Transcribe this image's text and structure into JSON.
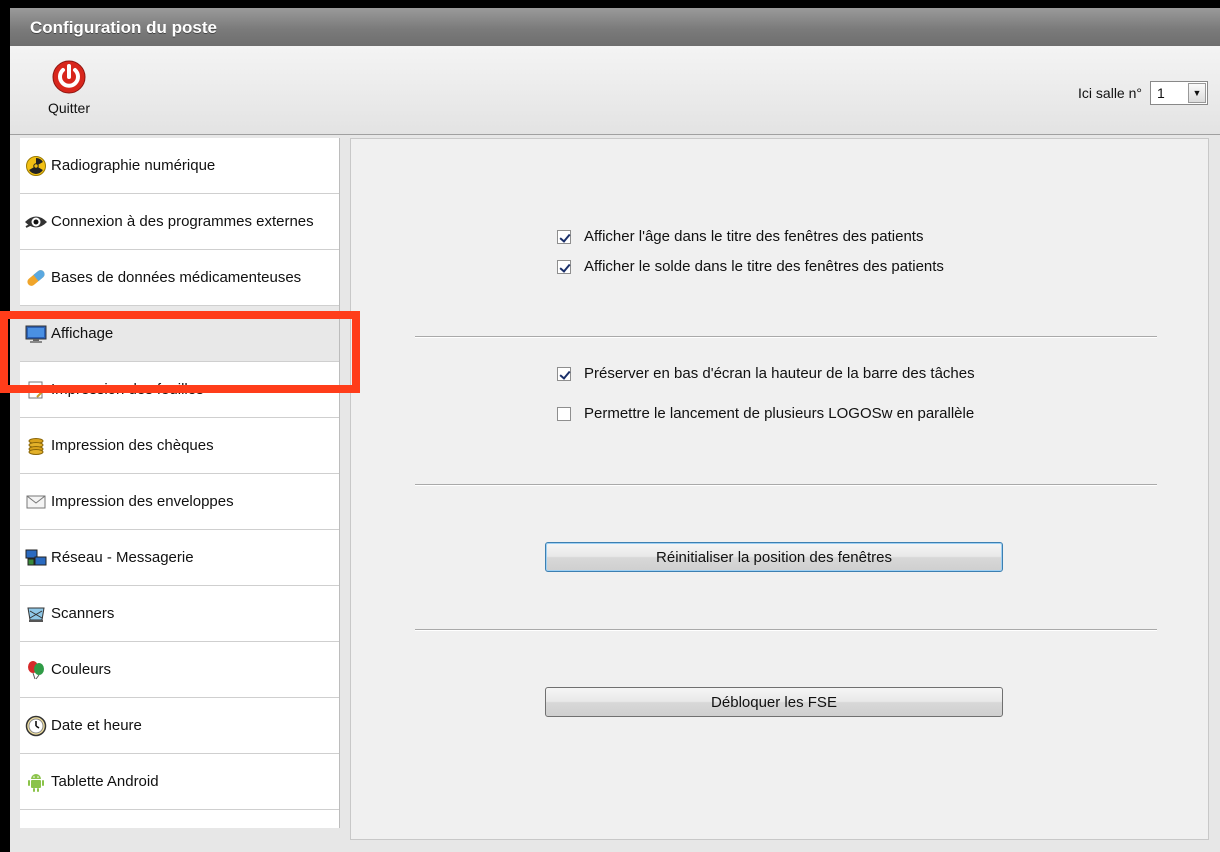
{
  "window": {
    "title": "Configuration du poste"
  },
  "toolbar": {
    "quit_label": "Quitter",
    "salle_label": "Ici salle n°",
    "salle_value": "1"
  },
  "sidebar": {
    "items": [
      {
        "label": "Radiographie numérique",
        "icon": "radiation-icon"
      },
      {
        "label": "Connexion à des programmes externes",
        "icon": "eye-icon"
      },
      {
        "label": "Bases de données médicamenteuses",
        "icon": "pill-icon"
      },
      {
        "label": "Affichage",
        "icon": "monitor-icon",
        "active": true
      },
      {
        "label": "Impression des feuilles",
        "icon": "document-icon"
      },
      {
        "label": "Impression des chèques",
        "icon": "cheque-icon"
      },
      {
        "label": "Impression des enveloppes",
        "icon": "envelope-icon"
      },
      {
        "label": "Réseau - Messagerie",
        "icon": "network-icon"
      },
      {
        "label": "Scanners",
        "icon": "scanner-icon"
      },
      {
        "label": "Couleurs",
        "icon": "balloons-icon"
      },
      {
        "label": "Date et heure",
        "icon": "clock-icon"
      },
      {
        "label": "Tablette Android",
        "icon": "android-icon"
      }
    ]
  },
  "content": {
    "checkboxes": [
      {
        "label": "Afficher l'âge dans le titre des fenêtres des patients",
        "checked": true
      },
      {
        "label": "Afficher le solde dans le titre des fenêtres des patients",
        "checked": true
      },
      {
        "label": "Préserver en bas d'écran la hauteur de la barre des tâches",
        "checked": true
      },
      {
        "label": "Permettre le lancement de plusieurs LOGOSw en parallèle",
        "checked": false
      }
    ],
    "reset_button": "Réinitialiser la position des fenêtres",
    "unlock_button": "Débloquer les FSE"
  },
  "colors": {
    "highlight": "#ff3d1a",
    "quit_red": "#d8261c",
    "focus_blue": "#3c7fb1"
  }
}
